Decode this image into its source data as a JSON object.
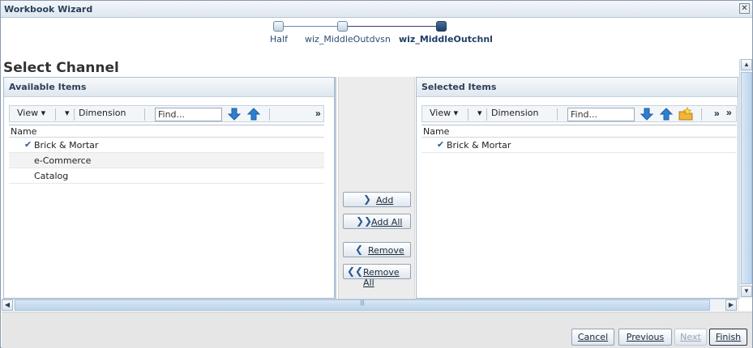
{
  "window": {
    "title": "Workbook Wizard",
    "close_glyph": "✕"
  },
  "train": {
    "stops": [
      {
        "label": "Half",
        "state": "visited"
      },
      {
        "label": "wiz_MiddleOutdvsn",
        "state": "visited"
      },
      {
        "label": "wiz_MiddleOutchnl",
        "state": "current"
      }
    ]
  },
  "page": {
    "section_title": "Select Channel"
  },
  "available": {
    "header": "Available Items",
    "toolbar": {
      "view": "View ▾",
      "dimension": "Dimension",
      "find_placeholder": "Find...",
      "more": "»"
    },
    "column": "Name",
    "rows": [
      {
        "label": "Brick & Mortar",
        "checked": true
      },
      {
        "label": "e-Commerce",
        "checked": false
      },
      {
        "label": "Catalog",
        "checked": false
      }
    ]
  },
  "selected": {
    "header": "Selected Items",
    "toolbar": {
      "view": "View ▾",
      "dimension": "Dimension",
      "find_placeholder": "Find...",
      "more": "»",
      "overflow": "»"
    },
    "column": "Name",
    "rows": [
      {
        "label": "Brick & Mortar",
        "checked": true
      }
    ]
  },
  "shuttle": {
    "add": "Add",
    "add_all": "Add All",
    "remove": "Remove",
    "remove_all": "Remove All"
  },
  "footer": {
    "cancel": "Cancel",
    "previous": "Previous",
    "next": "Next",
    "finish": "Finish"
  },
  "icons": {
    "check": "✔",
    "move_down": "down-arrow-icon",
    "move_up": "up-arrow-icon",
    "favorite_folder": "star-folder-icon"
  },
  "colors": {
    "accent": "#1f3f66",
    "panel_border": "#a9bccf",
    "arrow_blue": "#2f7fd0"
  }
}
